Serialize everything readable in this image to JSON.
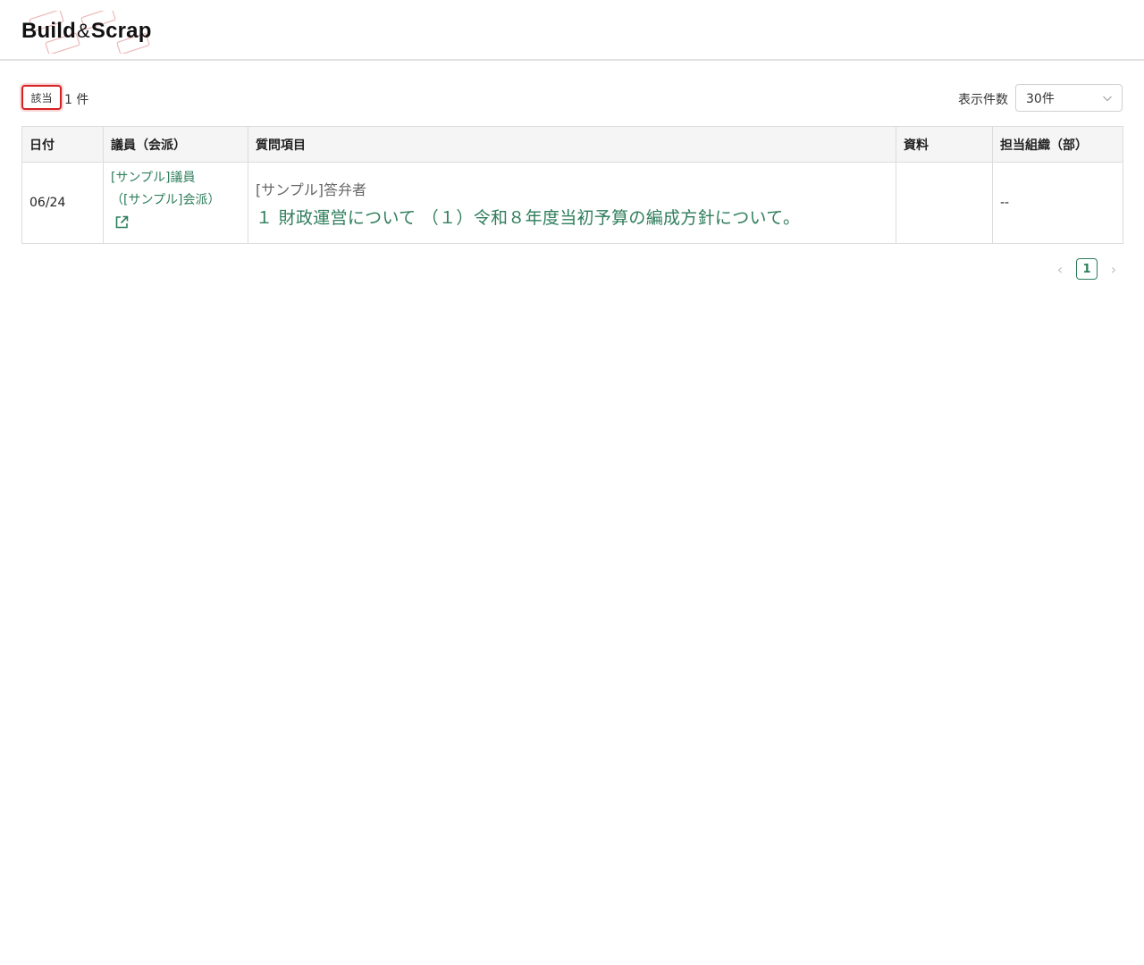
{
  "header": {
    "logo_text": {
      "part1": "Build",
      "amp": "&",
      "part2": "Scrap"
    }
  },
  "toolbar": {
    "count_tag": "該当",
    "count_value": "1 件",
    "per_page_label": "表示件数",
    "per_page_selected": "30件"
  },
  "table": {
    "columns": [
      "日付",
      "議員（会派）",
      "質問項目",
      "資料",
      "担当組織（部）"
    ],
    "rows": [
      {
        "date": "06/24",
        "member_name": "[サンプル]議員",
        "member_faction": "（[サンプル]会派）",
        "answerer": "[サンプル]答弁者",
        "question": "１ 財政運営について （１）令和８年度当初予算の編成方針について。",
        "material": "",
        "department": "--"
      }
    ]
  },
  "pagination": {
    "prev": "‹",
    "current": "1",
    "next": "›"
  },
  "colors": {
    "accent": "#2e7d5b",
    "highlight_border": "#d62222",
    "header_bg": "#f5f5f5"
  },
  "icons": {
    "external": "external-link-icon",
    "chevron": "chevron-down-icon"
  }
}
